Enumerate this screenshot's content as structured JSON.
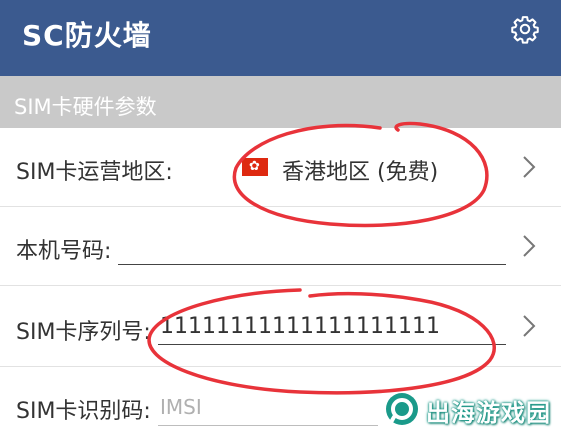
{
  "app": {
    "title": "SC防火墙",
    "settings_icon": "gear-icon"
  },
  "section": {
    "title": "SIM卡硬件参数"
  },
  "rows": {
    "region": {
      "label": "SIM卡运营地区:",
      "value": "香港地区 (免费)",
      "flag_icon": "hong-kong-flag-icon"
    },
    "phone_number": {
      "label": "本机号码:",
      "value": ""
    },
    "serial": {
      "label": "SIM卡序列号:",
      "value": "11111111111111111111"
    },
    "imsi": {
      "label": "SIM卡识别码:",
      "placeholder": "IMSI"
    }
  },
  "watermark": {
    "text": "出海游戏园"
  },
  "colors": {
    "topbar": "#3b5a8f",
    "section_header": "#c9c9c9",
    "annotation_red": "#e8333a",
    "flag_red": "#de2910"
  }
}
